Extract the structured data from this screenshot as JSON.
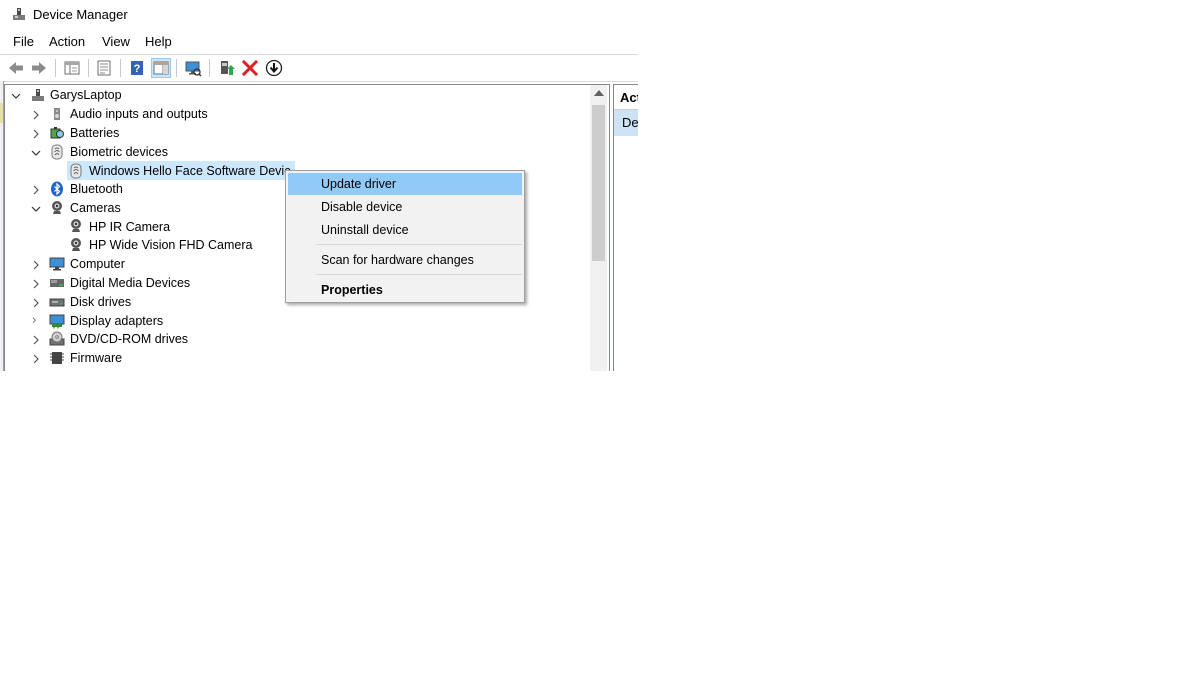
{
  "window": {
    "title": "Device Manager",
    "icon": "device-manager-icon"
  },
  "menubar": {
    "items": [
      "File",
      "Action",
      "View",
      "Help"
    ]
  },
  "toolbar": {
    "buttons": [
      "back-icon",
      "forward-icon",
      "show-hide-console-tree-icon",
      "properties-icon",
      "help-icon",
      "show-hide-action-pane-icon",
      "scan-hardware-icon",
      "update-driver-icon",
      "uninstall-icon",
      "disable-icon"
    ]
  },
  "tree": {
    "root": "GarysLaptop",
    "items": [
      {
        "label": "Audio inputs and outputs",
        "expanded": false,
        "icon": "speaker-icon"
      },
      {
        "label": "Batteries",
        "expanded": false,
        "icon": "battery-icon"
      },
      {
        "label": "Biometric devices",
        "expanded": true,
        "icon": "fingerprint-icon"
      },
      {
        "label": "Windows Hello Face Software Devic",
        "child": true,
        "selected": true,
        "icon": "fingerprint-icon"
      },
      {
        "label": "Bluetooth",
        "expanded": false,
        "icon": "bluetooth-icon"
      },
      {
        "label": "Cameras",
        "expanded": true,
        "icon": "camera-icon"
      },
      {
        "label": "HP IR Camera",
        "child": true,
        "icon": "camera-icon"
      },
      {
        "label": "HP Wide Vision FHD Camera",
        "child": true,
        "icon": "camera-icon"
      },
      {
        "label": "Computer",
        "expanded": false,
        "icon": "monitor-icon"
      },
      {
        "label": "Digital Media Devices",
        "expanded": false,
        "icon": "media-device-icon"
      },
      {
        "label": "Disk drives",
        "expanded": false,
        "icon": "disk-drive-icon"
      },
      {
        "label": "Display adapters",
        "expanded": false,
        "icon": "display-adapter-icon"
      },
      {
        "label": "DVD/CD-ROM drives",
        "expanded": false,
        "icon": "dvd-drive-icon"
      },
      {
        "label": "Firmware",
        "expanded": false,
        "icon": "firmware-icon"
      }
    ]
  },
  "actions_pane": {
    "header": "Act",
    "selected_item": "Dev"
  },
  "context_menu": {
    "items": [
      "Update driver",
      "Disable device",
      "Uninstall device",
      "Scan for hardware changes",
      "Properties"
    ],
    "highlighted": "Update driver",
    "default": "Properties"
  },
  "colors": {
    "selection": "#cce8ff",
    "menu_highlight": "#91c9f7",
    "menu_background": "#f2f2f2"
  }
}
